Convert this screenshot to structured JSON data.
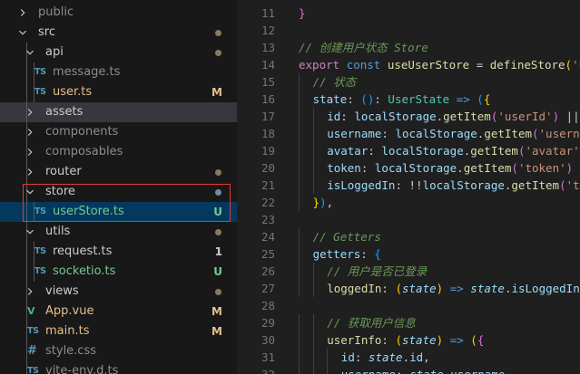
{
  "explorer": {
    "items": [
      {
        "name": "public",
        "kind": "folder",
        "expanded": false,
        "depth": 1,
        "dim": true,
        "git": ""
      },
      {
        "name": "src",
        "kind": "folder",
        "expanded": true,
        "depth": 1,
        "git": "dot"
      },
      {
        "name": "api",
        "kind": "folder",
        "expanded": true,
        "depth": 2,
        "git": "dot"
      },
      {
        "name": "message.ts",
        "kind": "file",
        "icon": "TS",
        "depth": 3,
        "dim": true,
        "git": ""
      },
      {
        "name": "user.ts",
        "kind": "file",
        "icon": "TS",
        "depth": 3,
        "git": "M"
      },
      {
        "name": "assets",
        "kind": "folder",
        "expanded": false,
        "depth": 2,
        "git": "",
        "selected": true
      },
      {
        "name": "components",
        "kind": "folder",
        "expanded": false,
        "depth": 2,
        "dim": true,
        "git": ""
      },
      {
        "name": "composables",
        "kind": "folder",
        "expanded": false,
        "depth": 2,
        "dim": true,
        "git": ""
      },
      {
        "name": "router",
        "kind": "folder",
        "expanded": false,
        "depth": 2,
        "git": "dot"
      },
      {
        "name": "store",
        "kind": "folder",
        "expanded": true,
        "depth": 2,
        "git": "dot-blue"
      },
      {
        "name": "userStore.ts",
        "kind": "file",
        "icon": "TS",
        "depth": 3,
        "git": "U",
        "active": true
      },
      {
        "name": "utils",
        "kind": "folder",
        "expanded": true,
        "depth": 2,
        "git": "dot"
      },
      {
        "name": "request.ts",
        "kind": "file",
        "icon": "TS",
        "depth": 3,
        "git": "1"
      },
      {
        "name": "socketio.ts",
        "kind": "file",
        "icon": "TS",
        "depth": 3,
        "git": "U"
      },
      {
        "name": "views",
        "kind": "folder",
        "expanded": false,
        "depth": 2,
        "git": "dot"
      },
      {
        "name": "App.vue",
        "kind": "file",
        "icon": "V",
        "depth": 2,
        "git": "M"
      },
      {
        "name": "main.ts",
        "kind": "file",
        "icon": "TS",
        "depth": 2,
        "git": "M"
      },
      {
        "name": "style.css",
        "kind": "file",
        "icon": "#",
        "depth": 2,
        "dim": true,
        "git": ""
      },
      {
        "name": "vite-env.d.ts",
        "kind": "file",
        "icon": "TS",
        "depth": 2,
        "dim": true,
        "git": ""
      }
    ]
  },
  "editor": {
    "first_line_number": 11,
    "lines": [
      {
        "indent": 0,
        "tokens": [
          [
            "br2",
            "}"
          ]
        ]
      },
      {
        "indent": 0,
        "tokens": []
      },
      {
        "indent": 0,
        "tokens": [
          [
            "cmt",
            "// 创建用户状态 Store"
          ]
        ]
      },
      {
        "indent": 0,
        "tokens": [
          [
            "ctl",
            "export"
          ],
          [
            "punc",
            " "
          ],
          [
            "kw",
            "const"
          ],
          [
            "punc",
            " "
          ],
          [
            "fn",
            "useUserStore"
          ],
          [
            "punc",
            " = "
          ],
          [
            "fn",
            "defineStore"
          ],
          [
            "br1",
            "("
          ],
          [
            "str",
            "'user'"
          ],
          [
            "punc",
            ", "
          ],
          [
            "br2",
            "{"
          ]
        ]
      },
      {
        "indent": 1,
        "tokens": [
          [
            "cmt",
            "// 状态"
          ]
        ]
      },
      {
        "indent": 1,
        "tokens": [
          [
            "prop",
            "state"
          ],
          [
            "punc",
            ": "
          ],
          [
            "br3",
            "("
          ],
          [
            "br3",
            ")"
          ],
          [
            "punc",
            ": "
          ],
          [
            "type",
            "UserState"
          ],
          [
            "punc",
            " "
          ],
          [
            "kw",
            "=>"
          ],
          [
            "punc",
            " "
          ],
          [
            "br3",
            "("
          ],
          [
            "br1",
            "{"
          ]
        ]
      },
      {
        "indent": 2,
        "tokens": [
          [
            "prop",
            "id"
          ],
          [
            "punc",
            ": "
          ],
          [
            "prop",
            "localStorage"
          ],
          [
            "punc",
            "."
          ],
          [
            "fn",
            "getItem"
          ],
          [
            "br2",
            "("
          ],
          [
            "str",
            "'userId'"
          ],
          [
            "br2",
            ")"
          ],
          [
            "punc",
            " || "
          ],
          [
            "str",
            "''"
          ],
          [
            "punc",
            ","
          ]
        ]
      },
      {
        "indent": 2,
        "tokens": [
          [
            "prop",
            "username"
          ],
          [
            "punc",
            ": "
          ],
          [
            "prop",
            "localStorage"
          ],
          [
            "punc",
            "."
          ],
          [
            "fn",
            "getItem"
          ],
          [
            "br2",
            "("
          ],
          [
            "str",
            "'username'"
          ],
          [
            "br2",
            ")"
          ],
          [
            "punc",
            " || "
          ],
          [
            "str",
            "''"
          ],
          [
            "punc",
            ","
          ]
        ]
      },
      {
        "indent": 2,
        "tokens": [
          [
            "prop",
            "avatar"
          ],
          [
            "punc",
            ": "
          ],
          [
            "prop",
            "localStorage"
          ],
          [
            "punc",
            "."
          ],
          [
            "fn",
            "getItem"
          ],
          [
            "br2",
            "("
          ],
          [
            "str",
            "'avatar'"
          ],
          [
            "br2",
            ")"
          ],
          [
            "punc",
            " || "
          ],
          [
            "str",
            "''"
          ],
          [
            "punc",
            ","
          ]
        ]
      },
      {
        "indent": 2,
        "tokens": [
          [
            "prop",
            "token"
          ],
          [
            "punc",
            ": "
          ],
          [
            "prop",
            "localStorage"
          ],
          [
            "punc",
            "."
          ],
          [
            "fn",
            "getItem"
          ],
          [
            "br2",
            "("
          ],
          [
            "str",
            "'token'"
          ],
          [
            "br2",
            ")"
          ],
          [
            "punc",
            " || "
          ],
          [
            "str",
            "''"
          ],
          [
            "punc",
            ","
          ]
        ]
      },
      {
        "indent": 2,
        "tokens": [
          [
            "prop",
            "isLoggedIn"
          ],
          [
            "punc",
            ": !!"
          ],
          [
            "prop",
            "localStorage"
          ],
          [
            "punc",
            "."
          ],
          [
            "fn",
            "getItem"
          ],
          [
            "br2",
            "("
          ],
          [
            "str",
            "'token'"
          ],
          [
            "br2",
            ")"
          ]
        ]
      },
      {
        "indent": 1,
        "tokens": [
          [
            "br1",
            "}"
          ],
          [
            "br3",
            ")"
          ],
          [
            "punc",
            ","
          ]
        ]
      },
      {
        "indent": 0,
        "tokens": []
      },
      {
        "indent": 1,
        "tokens": [
          [
            "cmt",
            "// Getters"
          ]
        ]
      },
      {
        "indent": 1,
        "tokens": [
          [
            "prop",
            "getters"
          ],
          [
            "punc",
            ": "
          ],
          [
            "br3",
            "{"
          ]
        ]
      },
      {
        "indent": 2,
        "tokens": [
          [
            "cmt",
            "// 用户是否已登录"
          ]
        ]
      },
      {
        "indent": 2,
        "tokens": [
          [
            "fn",
            "loggedIn"
          ],
          [
            "punc",
            ": "
          ],
          [
            "br1",
            "("
          ],
          [
            "var",
            "state"
          ],
          [
            "br1",
            ")"
          ],
          [
            "punc",
            " "
          ],
          [
            "kw",
            "=>"
          ],
          [
            "punc",
            " "
          ],
          [
            "var",
            "state"
          ],
          [
            "punc",
            "."
          ],
          [
            "prop",
            "isLoggedIn"
          ],
          [
            "punc",
            ","
          ]
        ]
      },
      {
        "indent": 0,
        "tokens": []
      },
      {
        "indent": 2,
        "tokens": [
          [
            "cmt",
            "// 获取用户信息"
          ]
        ]
      },
      {
        "indent": 2,
        "tokens": [
          [
            "fn",
            "userInfo"
          ],
          [
            "punc",
            ": "
          ],
          [
            "br1",
            "("
          ],
          [
            "var",
            "state"
          ],
          [
            "br1",
            ")"
          ],
          [
            "punc",
            " "
          ],
          [
            "kw",
            "=>"
          ],
          [
            "punc",
            " "
          ],
          [
            "br1",
            "("
          ],
          [
            "br2",
            "{"
          ]
        ]
      },
      {
        "indent": 3,
        "tokens": [
          [
            "prop",
            "id"
          ],
          [
            "punc",
            ": "
          ],
          [
            "var",
            "state"
          ],
          [
            "punc",
            "."
          ],
          [
            "prop",
            "id"
          ],
          [
            "punc",
            ","
          ]
        ]
      },
      {
        "indent": 3,
        "tokens": [
          [
            "prop",
            "username"
          ],
          [
            "punc",
            ": "
          ],
          [
            "var",
            "state"
          ],
          [
            "punc",
            "."
          ],
          [
            "prop",
            "username"
          ],
          [
            "punc",
            ","
          ]
        ]
      }
    ]
  }
}
